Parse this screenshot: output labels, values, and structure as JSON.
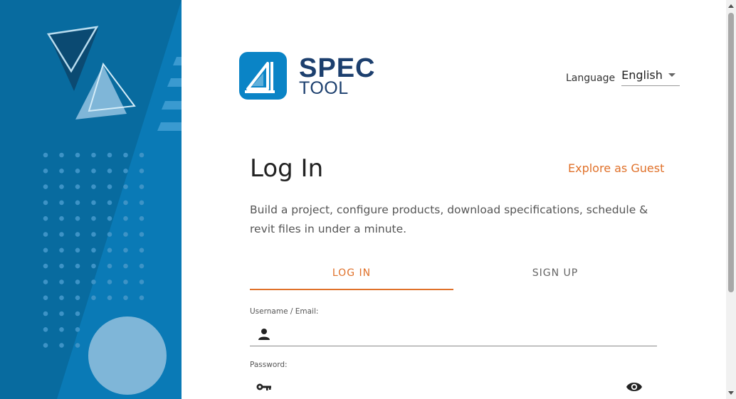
{
  "brand": {
    "name_line1": "SPEC",
    "name_line2": "TOOL",
    "colors": {
      "primary": "#1c3f6e",
      "accent": "#e0712a",
      "logo_bg": "#0a84c6",
      "panel": "#086b9f"
    }
  },
  "language": {
    "label": "Language",
    "selected": "English",
    "icon": "chevron-down-icon"
  },
  "login": {
    "title": "Log In",
    "guest_link": "Explore as Guest",
    "description": "Build a project, configure products, download specifications, schedule & revit files in under a minute.",
    "tabs": [
      {
        "label": "LOG IN",
        "active": true
      },
      {
        "label": "SIGN UP",
        "active": false
      }
    ],
    "username": {
      "label": "Username / Email:",
      "value": "",
      "placeholder": "",
      "icon": "user-icon"
    },
    "password": {
      "label": "Password:",
      "value": "",
      "placeholder": "",
      "icon": "key-icon",
      "toggle_icon": "eye-icon"
    }
  }
}
